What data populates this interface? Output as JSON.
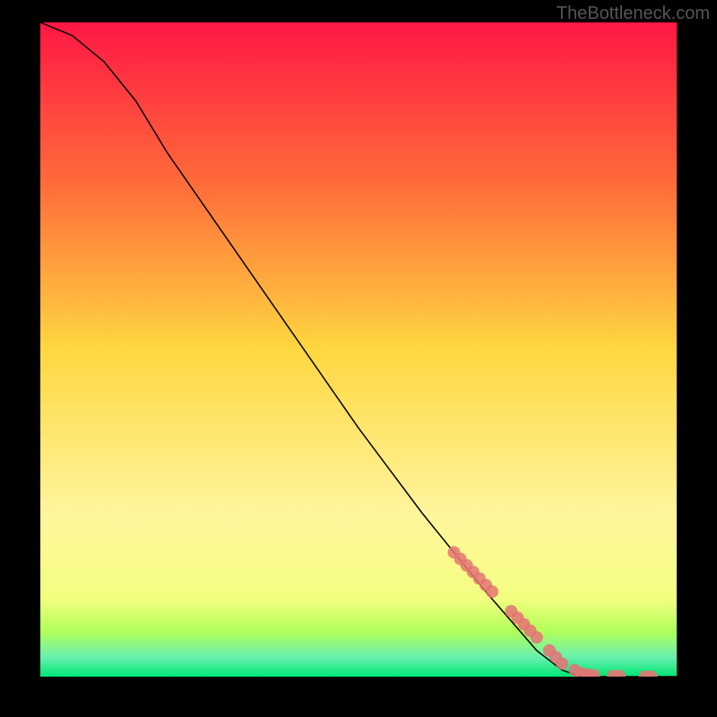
{
  "watermark": "TheBottleneck.com",
  "chart_data": {
    "type": "line",
    "title": "",
    "xlabel": "",
    "ylabel": "",
    "xlim": [
      0,
      100
    ],
    "ylim": [
      0,
      100
    ],
    "curve": [
      {
        "x": 0,
        "y": 100
      },
      {
        "x": 5,
        "y": 98
      },
      {
        "x": 10,
        "y": 94
      },
      {
        "x": 15,
        "y": 88
      },
      {
        "x": 20,
        "y": 80
      },
      {
        "x": 30,
        "y": 66
      },
      {
        "x": 40,
        "y": 52
      },
      {
        "x": 50,
        "y": 38
      },
      {
        "x": 60,
        "y": 25
      },
      {
        "x": 70,
        "y": 13
      },
      {
        "x": 78,
        "y": 4
      },
      {
        "x": 82,
        "y": 1
      },
      {
        "x": 85,
        "y": 0
      },
      {
        "x": 100,
        "y": 0
      }
    ],
    "highlight_points": [
      {
        "x": 65,
        "y": 19
      },
      {
        "x": 66,
        "y": 18
      },
      {
        "x": 67,
        "y": 17
      },
      {
        "x": 68,
        "y": 16
      },
      {
        "x": 69,
        "y": 15
      },
      {
        "x": 70,
        "y": 14
      },
      {
        "x": 71,
        "y": 13
      },
      {
        "x": 74,
        "y": 10
      },
      {
        "x": 75,
        "y": 9
      },
      {
        "x": 76,
        "y": 8
      },
      {
        "x": 77,
        "y": 7
      },
      {
        "x": 78,
        "y": 6
      },
      {
        "x": 80,
        "y": 4
      },
      {
        "x": 81,
        "y": 3
      },
      {
        "x": 82,
        "y": 2
      },
      {
        "x": 84,
        "y": 1
      },
      {
        "x": 85,
        "y": 0.5
      },
      {
        "x": 86,
        "y": 0.3
      },
      {
        "x": 87,
        "y": 0.2
      },
      {
        "x": 90,
        "y": 0.1
      },
      {
        "x": 91,
        "y": 0.1
      },
      {
        "x": 95,
        "y": 0
      },
      {
        "x": 96,
        "y": 0
      }
    ],
    "gradient_stops": [
      {
        "offset": 0,
        "color": "#ff1744"
      },
      {
        "offset": 25,
        "color": "#ff6d3a"
      },
      {
        "offset": 50,
        "color": "#ffd740"
      },
      {
        "offset": 75,
        "color": "#fff59d"
      },
      {
        "offset": 88,
        "color": "#f4ff81"
      },
      {
        "offset": 93,
        "color": "#b2ff59"
      },
      {
        "offset": 97,
        "color": "#69f0ae"
      },
      {
        "offset": 100,
        "color": "#00e676"
      }
    ]
  }
}
